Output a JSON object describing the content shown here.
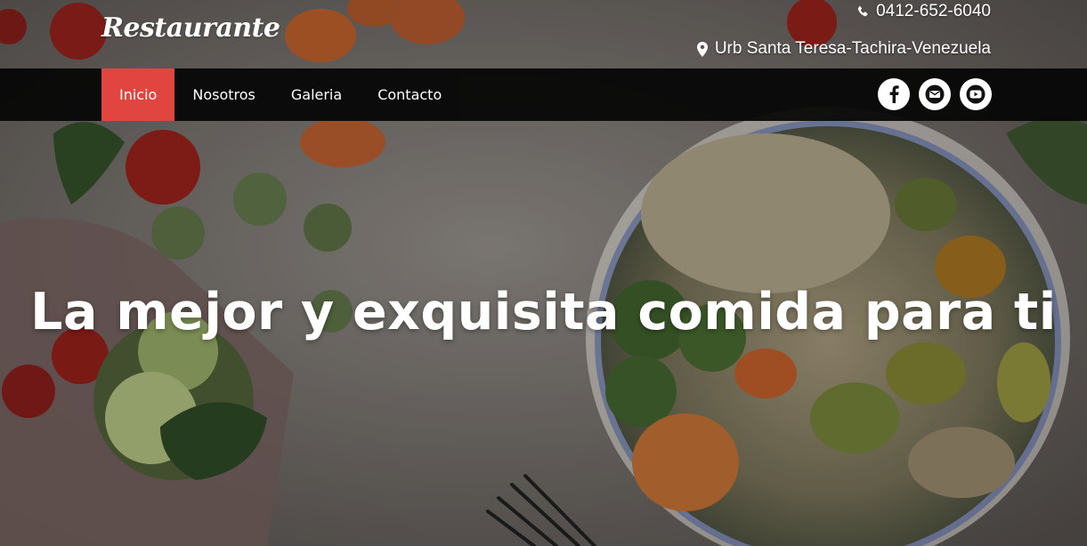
{
  "brand": {
    "name": "Restaurante"
  },
  "topbar": {
    "phone_icon": "phone-icon",
    "phone": "0412-652-6040",
    "address_icon": "map-marker-icon",
    "address": "Urb Santa Teresa-Tachira-Venezuela"
  },
  "nav": {
    "items": [
      {
        "label": "Inicio",
        "active": true
      },
      {
        "label": "Nosotros",
        "active": false
      },
      {
        "label": "Galeria",
        "active": false
      },
      {
        "label": "Contacto",
        "active": false
      }
    ],
    "active_color": "#e0453f"
  },
  "social": [
    {
      "icon": "facebook-icon"
    },
    {
      "icon": "envelope-icon"
    },
    {
      "icon": "youtube-icon"
    }
  ],
  "hero": {
    "headline": "La mejor y exquisita comida para ti"
  }
}
